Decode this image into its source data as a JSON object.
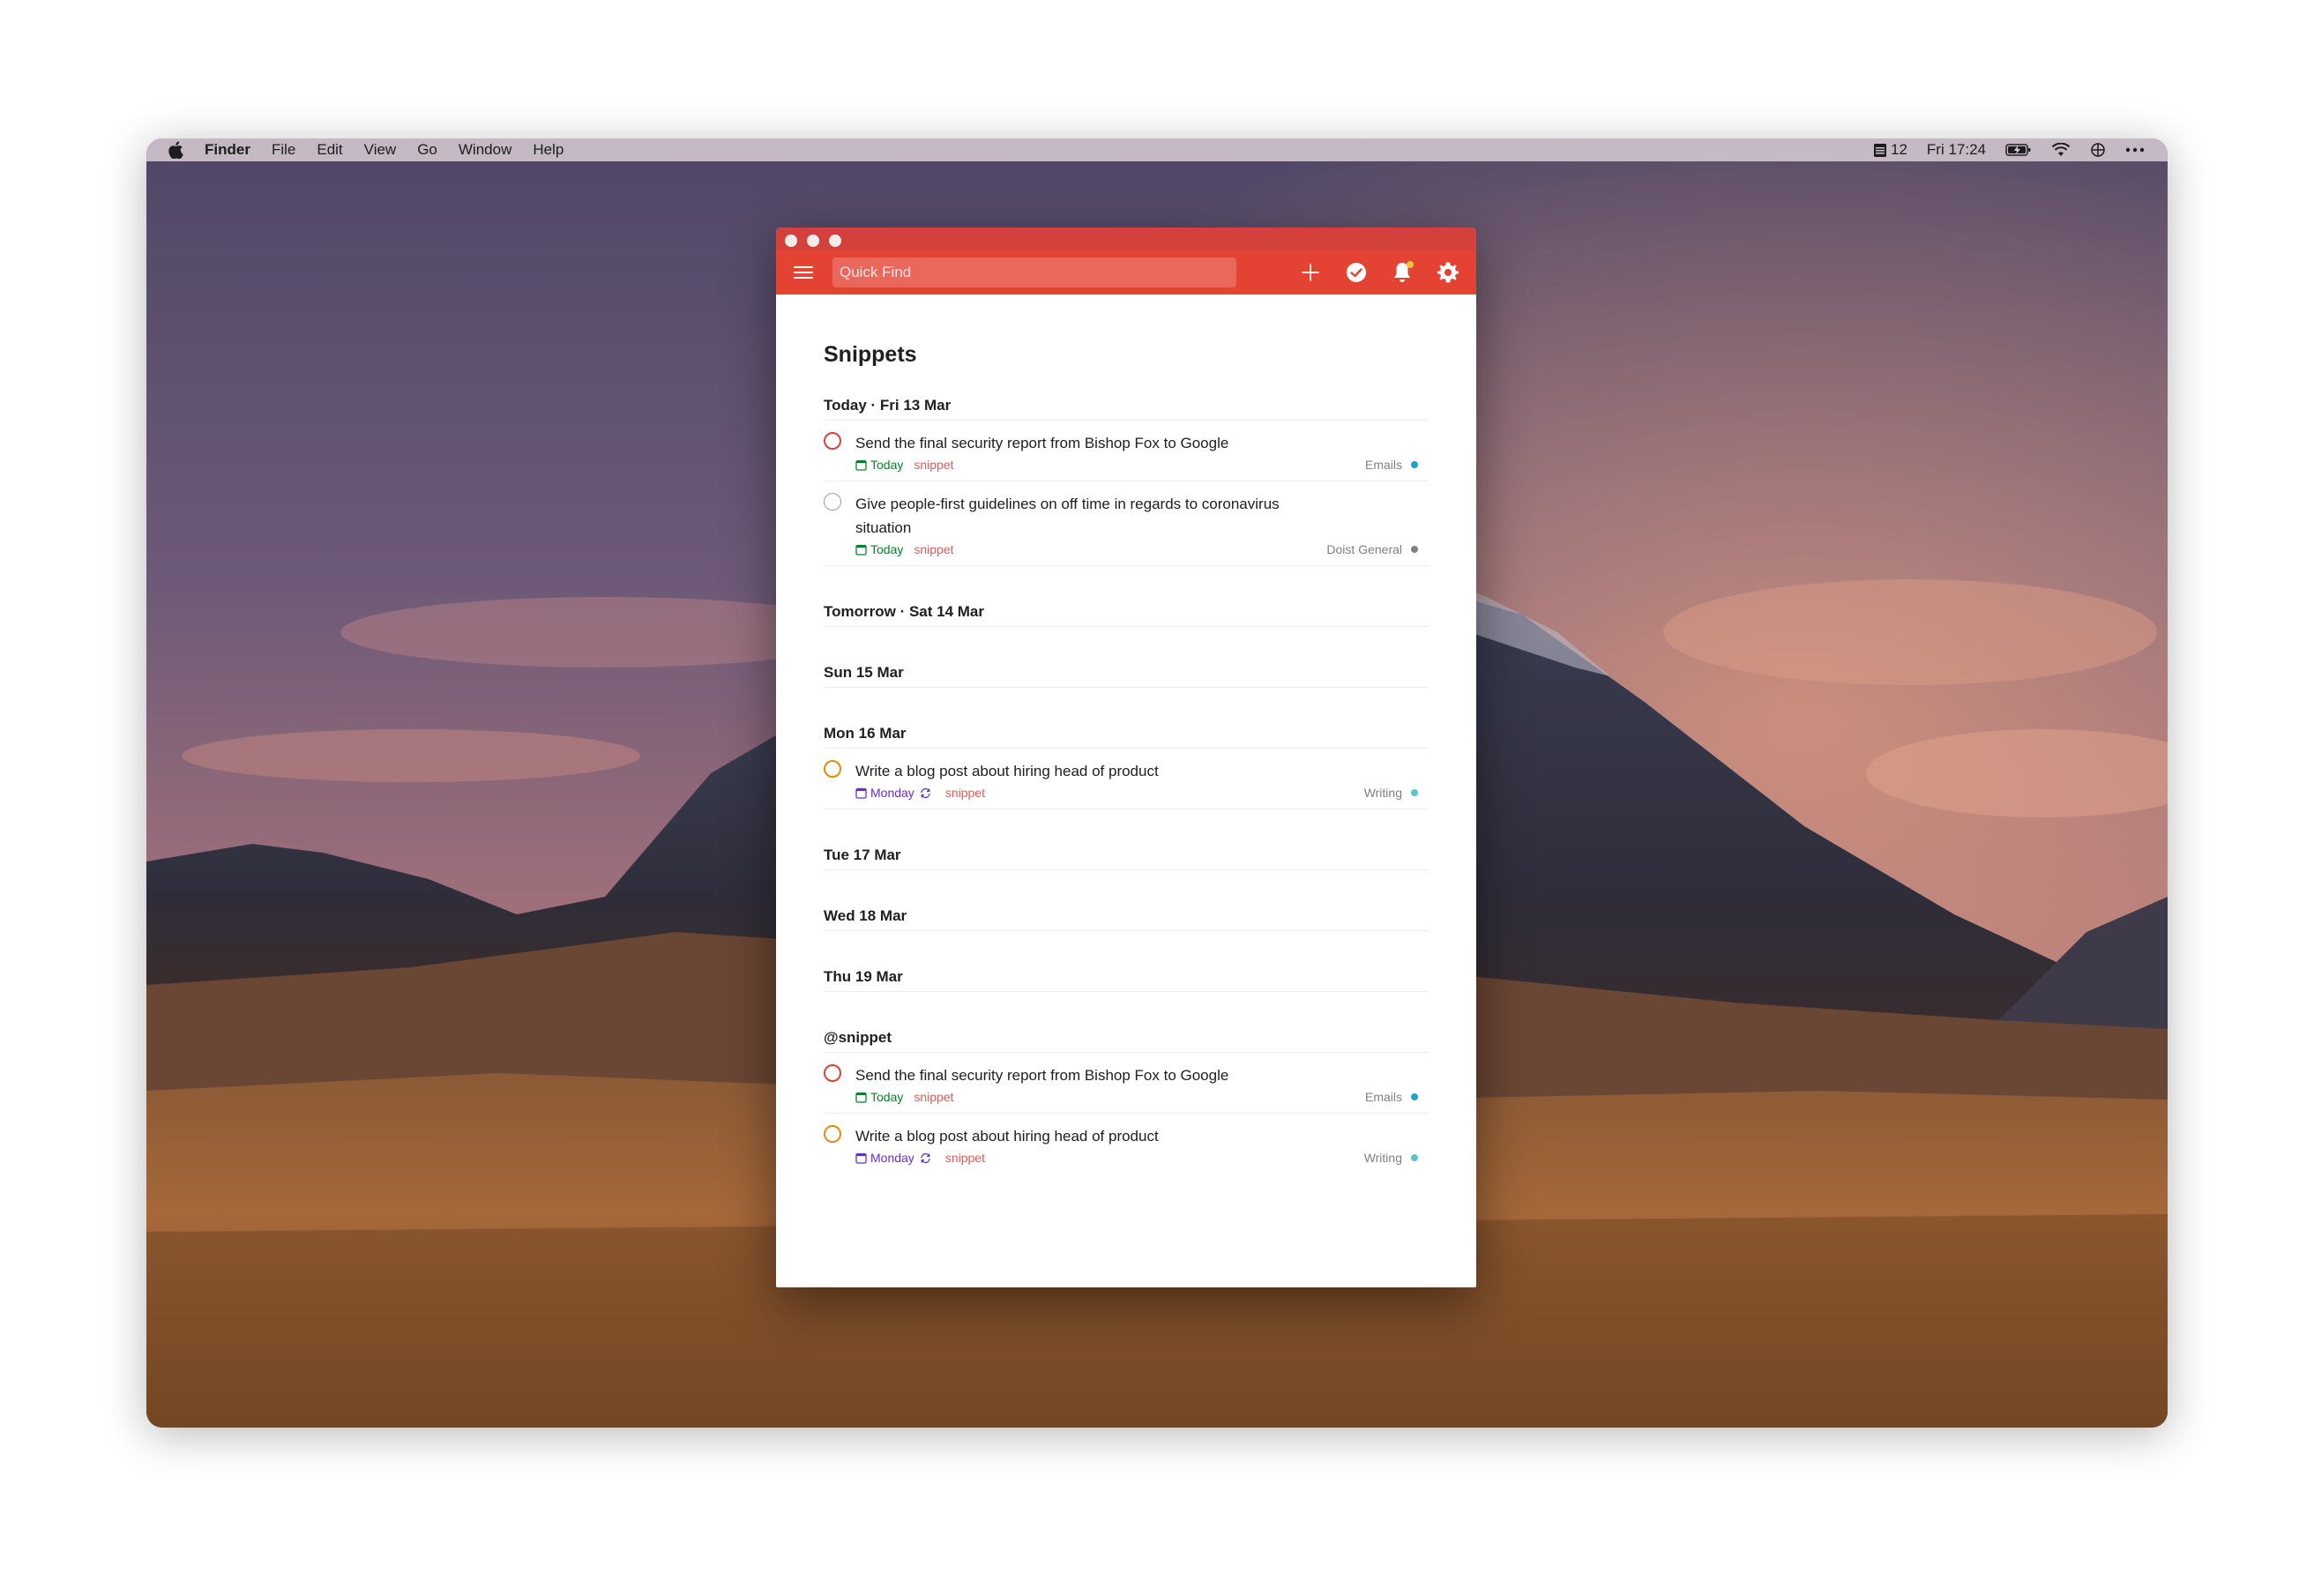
{
  "menubar": {
    "app": "Finder",
    "items": [
      "File",
      "Edit",
      "View",
      "Go",
      "Window",
      "Help"
    ],
    "status_number": "12",
    "clock": "Fri 17:24",
    "icons": [
      "apple-icon",
      "calendar-icon",
      "battery-icon",
      "wifi-icon",
      "control-center-icon",
      "more-icon"
    ]
  },
  "toolbar": {
    "search_placeholder": "Quick Find",
    "icons": [
      "hamburger-icon",
      "plus-icon",
      "check-circle-icon",
      "bell-icon",
      "gear-icon"
    ]
  },
  "page": {
    "title": "Snippets"
  },
  "sections": {
    "today": {
      "header": "Today · Fri 13 Mar",
      "tasks": [
        {
          "text": "Send the final security report from Bishop Fox to Google",
          "date": "Today",
          "label": "snippet",
          "project": "Emails",
          "project_color": "#1ea3c7",
          "priority_color": "#d1453b"
        },
        {
          "text": "Give people-first guidelines on off time in regards to coronavirus situation",
          "date": "Today",
          "label": "snippet",
          "project": "Doist General",
          "project_color": "#808080",
          "priority_color": "#9e9e9e"
        }
      ]
    },
    "tomorrow": {
      "header": "Tomorrow · Sat 14 Mar"
    },
    "sun": {
      "header": "Sun 15 Mar"
    },
    "mon": {
      "header": "Mon 16 Mar",
      "tasks": [
        {
          "text": "Write a blog post about hiring head of product",
          "date": "Monday",
          "label": "snippet",
          "project": "Writing",
          "project_color": "#5ac6c8",
          "priority_color": "#eb8909"
        }
      ]
    },
    "tue": {
      "header": "Tue 17 Mar"
    },
    "wed": {
      "header": "Wed 18 Mar"
    },
    "thu": {
      "header": "Thu 19 Mar"
    },
    "snippet": {
      "header": "@snippet",
      "tasks": [
        {
          "text": "Send the final security report from Bishop Fox to Google",
          "date": "Today",
          "label": "snippet",
          "project": "Emails",
          "project_color": "#1ea3c7",
          "priority_color": "#d1453b"
        },
        {
          "text": "Write a blog post about hiring head of product",
          "date": "Monday",
          "label": "snippet",
          "project": "Writing",
          "project_color": "#5ac6c8",
          "priority_color": "#eb8909"
        }
      ]
    }
  },
  "colors": {
    "brand_red": "#e44232",
    "titlebar_red": "#d4403a",
    "today_green": "#058527",
    "upcoming_purple": "#692fc2",
    "label_red": "#e05c5c"
  }
}
